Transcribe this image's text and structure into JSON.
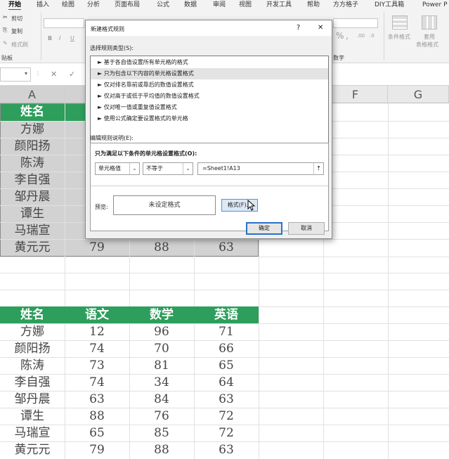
{
  "ribbon": {
    "tabs": [
      "开始",
      "插入",
      "绘图",
      "分析",
      "页面布局",
      "公式",
      "数据",
      "审阅",
      "视图",
      "开发工具",
      "帮助",
      "方方格子",
      "DIY工具箱",
      "Power P"
    ],
    "clipboard": {
      "cut": "剪切",
      "copy": "复制",
      "format_painter": "格式刷",
      "group": "贴板"
    },
    "font_buttons": {
      "bold": "B",
      "italic": "I",
      "underline": "U"
    },
    "number": {
      "percent": "%",
      "comma": ",",
      "group": "数字",
      "dec1": ".00",
      "dec2": ".0"
    },
    "styles": {
      "conditional": "条件格式",
      "table_line1": "套用",
      "table_line2": "表格格式"
    }
  },
  "formula_bar": {
    "cancel": "✕",
    "enter": "✓"
  },
  "sheet": {
    "columns": [
      "A",
      "F",
      "G"
    ],
    "top_table": {
      "header": "姓名",
      "names": [
        "方娜",
        "颜阳扬",
        "陈涛",
        "李自强",
        "邹丹晨",
        "谭生",
        "马瑞宣",
        "黄元元"
      ],
      "last_row_values": [
        "79",
        "88",
        "63"
      ]
    },
    "bottom_table": {
      "headers": [
        "姓名",
        "语文",
        "数学",
        "英语"
      ],
      "rows": [
        [
          "方娜",
          "12",
          "96",
          "71"
        ],
        [
          "颜阳扬",
          "74",
          "70",
          "66"
        ],
        [
          "陈涛",
          "73",
          "81",
          "65"
        ],
        [
          "李自强",
          "74",
          "34",
          "64"
        ],
        [
          "邹丹晨",
          "63",
          "84",
          "63"
        ],
        [
          "谭生",
          "88",
          "76",
          "72"
        ],
        [
          "马瑞宣",
          "65",
          "85",
          "72"
        ],
        [
          "黄元元",
          "79",
          "88",
          "63"
        ]
      ]
    }
  },
  "dialog": {
    "title": "新建格式规则",
    "help": "?",
    "close": "✕",
    "rule_type_label": "选择规则类型(S):",
    "rule_types": [
      "► 基于各自值设置所有单元格的格式",
      "► 只为包含以下内容的单元格设置格式",
      "► 仅对排名靠前或靠后的数值设置格式",
      "► 仅对高于或低于平均值的数值设置格式",
      "► 仅对唯一值或重复值设置格式",
      "► 使用公式确定要设置格式的单元格"
    ],
    "selected_rule_index": 1,
    "edit_label": "编辑规则说明(E):",
    "condition_label": "只为满足以下条件的单元格设置格式(O):",
    "combo1": "单元格值",
    "combo2": "不等于",
    "formula": "=Sheet1!A13",
    "preview_label": "预览:",
    "preview_text": "未设定格式",
    "format_button": "格式(F)...",
    "ok": "确定",
    "cancel": "取消"
  },
  "colors": {
    "accent": "#217346",
    "header_green": "#2e9e5c",
    "selection_gray": "#d2d2d2"
  }
}
